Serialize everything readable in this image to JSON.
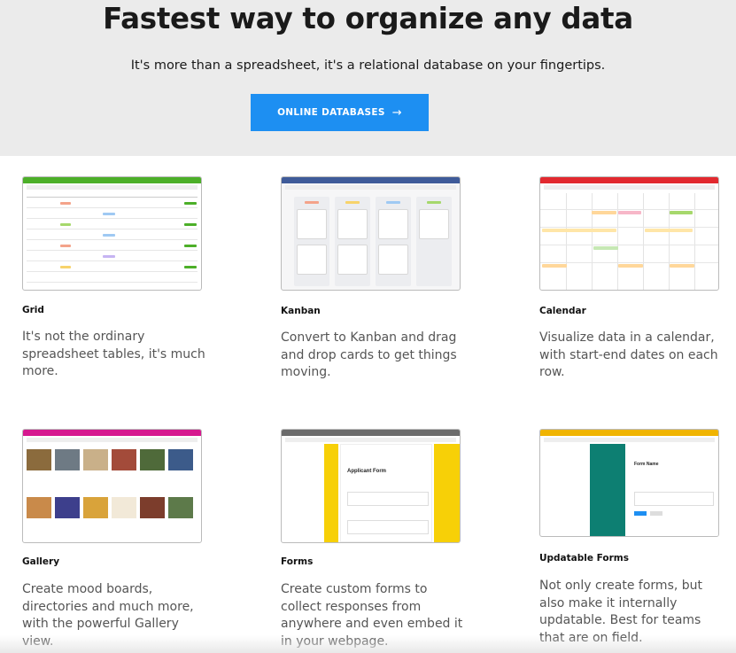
{
  "hero": {
    "title": "Fastest way to organize any data",
    "subtitle": "It's more than a spreadsheet, it's a relational database on your fingertips.",
    "cta_label": "ONLINE DATABASES",
    "cta_icon": "arrow-right-icon"
  },
  "colors": {
    "hero_bg": "#ebebeb",
    "cta_bg": "#1d8ff2",
    "grid_accent": "#4caf28",
    "kanban_accent": "#3f5b99",
    "calendar_accent": "#e2292f",
    "gallery_accent": "#d6188f",
    "forms_accent": "#6b6b6b",
    "updatable_accent": "#f0b400"
  },
  "features": [
    {
      "title": "Grid",
      "description": "It's not the ordinary spreadsheet tables, it's much more."
    },
    {
      "title": "Kanban",
      "description": "Convert to Kanban and drag and drop cards to get things moving."
    },
    {
      "title": "Calendar",
      "description": "Visualize data in a calendar, with start-end dates on each row."
    },
    {
      "title": "Gallery",
      "description": "Create mood boards, directories and much more, with the powerful Gallery view."
    },
    {
      "title": "Forms",
      "description": "Create custom forms to collect responses from anywhere and even embed it in your webpage."
    },
    {
      "title": "Updatable Forms",
      "description": "Not only create forms, but also make it internally updatable. Best for teams that are on field."
    }
  ],
  "mock": {
    "applicant_form": "Applicant Form",
    "form_name": "Form Name"
  }
}
